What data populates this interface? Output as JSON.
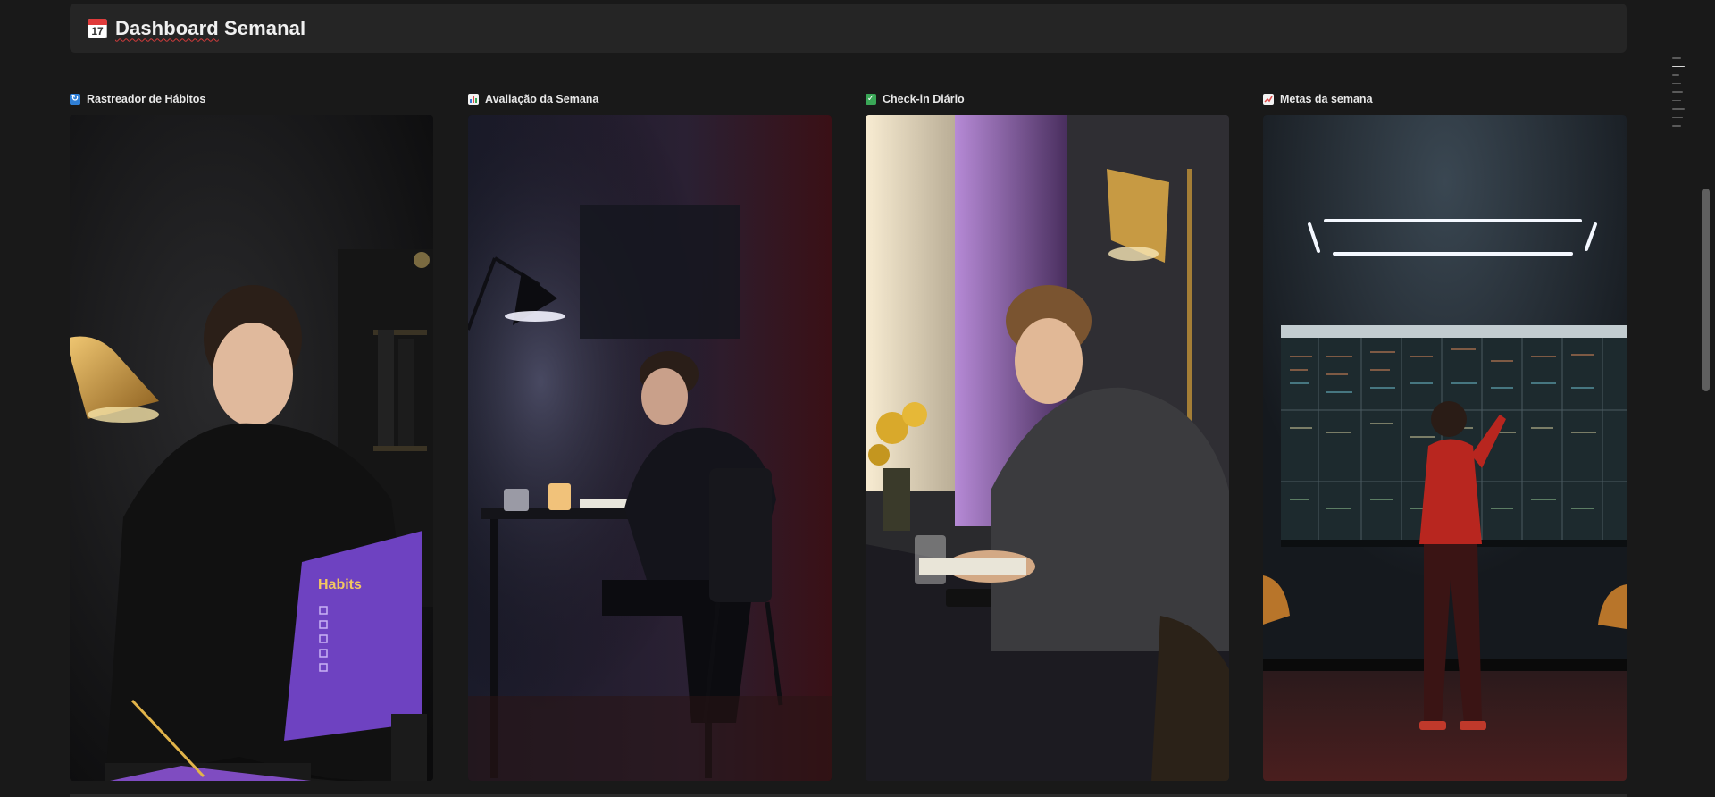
{
  "header": {
    "icon": "calendar-icon",
    "calendar_day": "17",
    "title_word1": "Dashboard",
    "title_word2": " Semanal"
  },
  "columns": [
    {
      "label": "Rastreador de Hábitos",
      "icon": "repeat-icon",
      "card_text": "Habits"
    },
    {
      "label": "Avaliação da Semana",
      "icon": "bar-chart-icon"
    },
    {
      "label": "Check-in Diário",
      "icon": "check-mark-icon"
    },
    {
      "label": "Metas da semana",
      "icon": "trend-chart-icon"
    }
  ],
  "colors": {
    "background": "#191919",
    "header_bg": "#252525",
    "text": "#e6e6e6"
  }
}
